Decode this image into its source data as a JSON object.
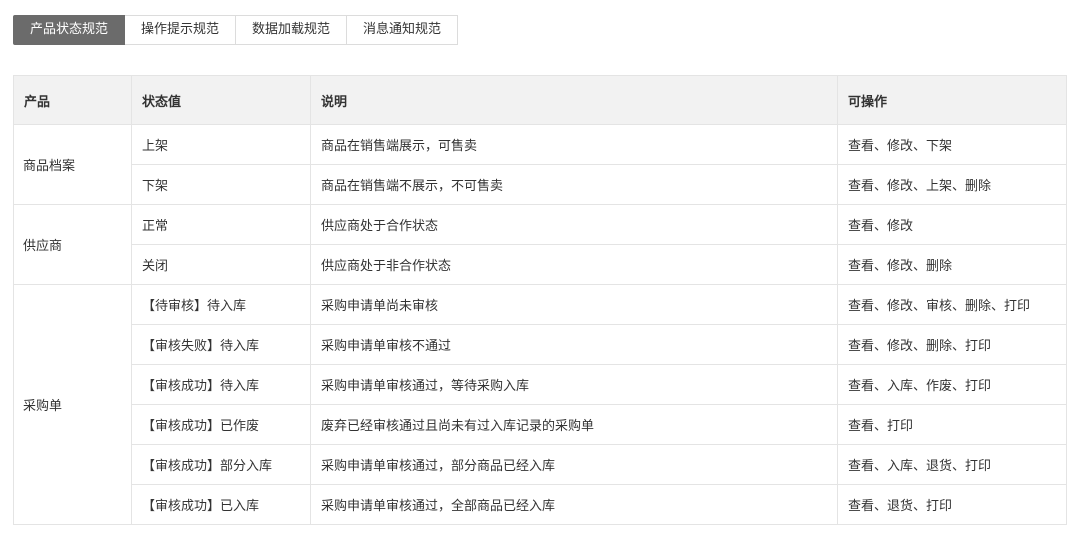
{
  "tabs": [
    {
      "label": "产品状态规范",
      "active": true
    },
    {
      "label": "操作提示规范",
      "active": false
    },
    {
      "label": "数据加载规范",
      "active": false
    },
    {
      "label": "消息通知规范",
      "active": false
    }
  ],
  "table": {
    "headers": [
      "产品",
      "状态值",
      "说明",
      "可操作"
    ],
    "groups": [
      {
        "product": "商品档案",
        "rows": [
          {
            "status": "上架",
            "desc": "商品在销售端展示，可售卖",
            "ops": "查看、修改、下架"
          },
          {
            "status": "下架",
            "desc": "商品在销售端不展示，不可售卖",
            "ops": "查看、修改、上架、删除"
          }
        ]
      },
      {
        "product": "供应商",
        "rows": [
          {
            "status": "正常",
            "desc": "供应商处于合作状态",
            "ops": "查看、修改"
          },
          {
            "status": "关闭",
            "desc": "供应商处于非合作状态",
            "ops": "查看、修改、删除"
          }
        ]
      },
      {
        "product": "采购单",
        "rows": [
          {
            "status": "【待审核】待入库",
            "desc": "采购申请单尚未审核",
            "ops": "查看、修改、审核、删除、打印"
          },
          {
            "status": "【审核失败】待入库",
            "desc": "采购申请单审核不通过",
            "ops": "查看、修改、删除、打印"
          },
          {
            "status": "【审核成功】待入库",
            "desc": "采购申请单审核通过，等待采购入库",
            "ops": "查看、入库、作废、打印"
          },
          {
            "status": "【审核成功】已作废",
            "desc": "废弃已经审核通过且尚未有过入库记录的采购单",
            "ops": "查看、打印"
          },
          {
            "status": "【审核成功】部分入库",
            "desc": "采购申请单审核通过，部分商品已经入库",
            "ops": "查看、入库、退货、打印"
          },
          {
            "status": "【审核成功】已入库",
            "desc": "采购申请单审核通过，全部商品已经入库",
            "ops": "查看、退货、打印"
          }
        ]
      }
    ]
  }
}
